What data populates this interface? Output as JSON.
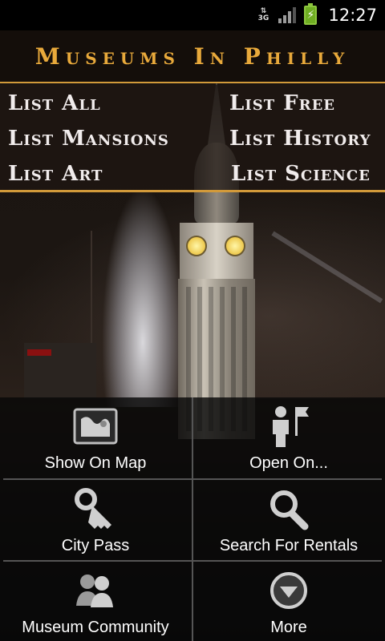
{
  "status_bar": {
    "network": "3G",
    "time": "12:27"
  },
  "header": {
    "title": "Museums In Philly"
  },
  "categories": [
    {
      "label": "List All"
    },
    {
      "label": "List Free"
    },
    {
      "label": "List Mansions"
    },
    {
      "label": "List History"
    },
    {
      "label": "List Art"
    },
    {
      "label": "List Science"
    }
  ],
  "menu": [
    {
      "label": "Show On Map",
      "icon": "map-icon"
    },
    {
      "label": "Open On...",
      "icon": "person-flag-icon"
    },
    {
      "label": "City Pass",
      "icon": "key-icon"
    },
    {
      "label": "Search For Rentals",
      "icon": "search-icon"
    },
    {
      "label": "Museum Community",
      "icon": "people-icon"
    },
    {
      "label": "More",
      "icon": "more-down-icon"
    }
  ],
  "colors": {
    "accent": "#e8a93b",
    "divider": "#d29a3a"
  }
}
